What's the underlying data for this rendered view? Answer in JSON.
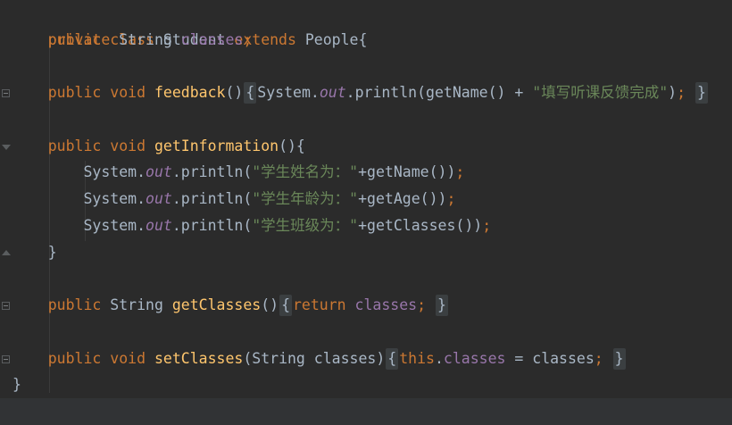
{
  "code": {
    "class_line": {
      "kw1": "public",
      "kw2": "class",
      "name": "Student",
      "kw3": "extends",
      "parent": "People{"
    },
    "field_line": {
      "kw": "private",
      "type": "String",
      "name": "classes",
      "end": ";"
    },
    "feedback_line": {
      "kw1": "public",
      "kw2": "void",
      "fn": "feedback",
      "parens": "()",
      "open": "{",
      "receiver": "System.",
      "out": "out",
      "call": ".println(getName() + ",
      "str": "\"填写听课反馈完成\"",
      "close_paren": ")",
      "semi": ";",
      "close": "}"
    },
    "getinfo_line": {
      "kw1": "public",
      "kw2": "void",
      "fn": "getInformation",
      "rest": "(){"
    },
    "println_lines": [
      {
        "receiver": "System.",
        "out": "out",
        "call": ".println(",
        "str": "\"学生姓名为：\"",
        "rest": "+getName())",
        "semi": ";"
      },
      {
        "receiver": "System.",
        "out": "out",
        "call": ".println(",
        "str": "\"学生年龄为：\"",
        "rest": "+getAge())",
        "semi": ";"
      },
      {
        "receiver": "System.",
        "out": "out",
        "call": ".println(",
        "str": "\"学生班级为：\"",
        "rest": "+getClasses())",
        "semi": ";"
      }
    ],
    "method_close": "}",
    "getclasses_line": {
      "kw1": "public",
      "type": "String",
      "fn": "getClasses",
      "parens": "()",
      "open": "{",
      "kw_return": "return",
      "field": "classes",
      "semi": ";",
      "close": "}"
    },
    "setclasses_line": {
      "kw1": "public",
      "kw2": "void",
      "fn": "setClasses",
      "params": "(String classes)",
      "open": "{",
      "kw_this": "this",
      "dot": ".",
      "field": "classes",
      "assign": " = classes",
      "semi": ";",
      "close": "}"
    },
    "class_close": "}"
  },
  "colors": {
    "background": "#2b2b2b",
    "keyword": "#cc7832",
    "function": "#ffc66d",
    "field": "#9876aa",
    "string": "#6a8759",
    "default": "#a9b7c6"
  }
}
